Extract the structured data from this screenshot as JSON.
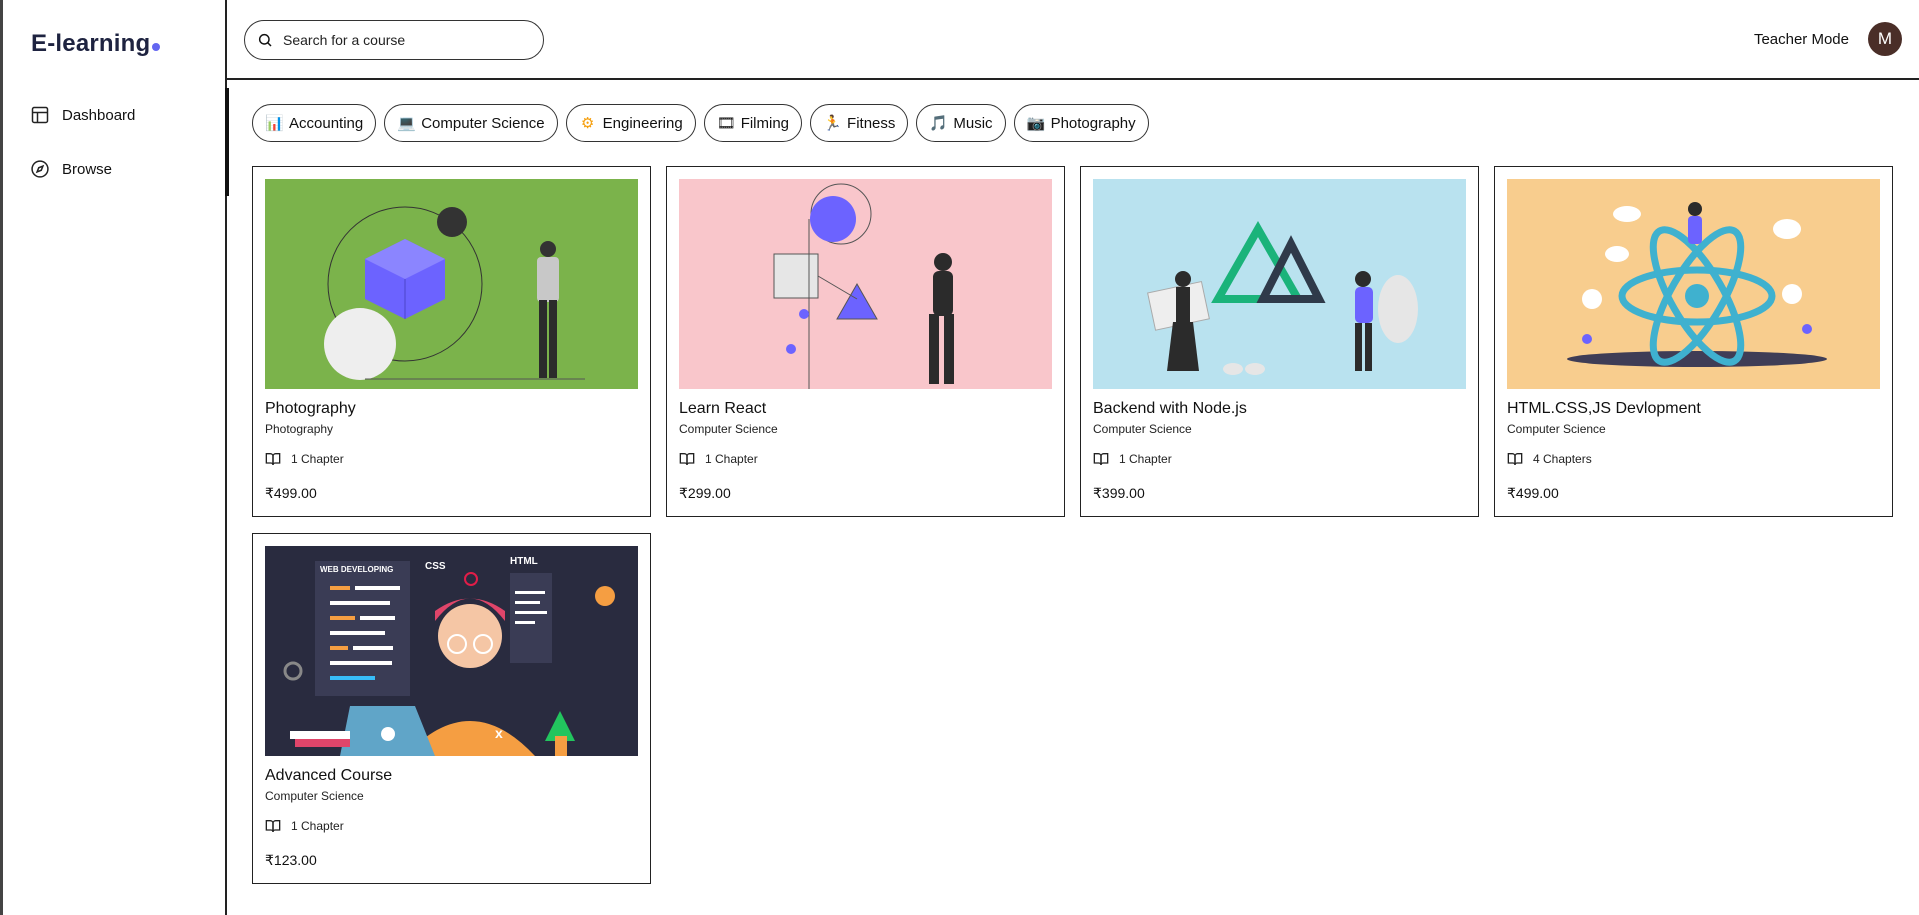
{
  "app": {
    "logo": "E-learning"
  },
  "sidebar": {
    "items": [
      {
        "label": "Dashboard",
        "icon": "layout-icon"
      },
      {
        "label": "Browse",
        "icon": "compass-icon"
      }
    ]
  },
  "header": {
    "search_placeholder": "Search for a course",
    "teacher_mode": "Teacher Mode",
    "avatar_initial": "M"
  },
  "categories": [
    {
      "label": "Accounting",
      "emoji": "📊"
    },
    {
      "label": "Computer Science",
      "emoji": "💻"
    },
    {
      "label": "Engineering",
      "emoji": "⚙"
    },
    {
      "label": "Filming",
      "emoji": "🎞"
    },
    {
      "label": "Fitness",
      "emoji": "🏃"
    },
    {
      "label": "Music",
      "emoji": "🎵"
    },
    {
      "label": "Photography",
      "emoji": "📷"
    }
  ],
  "courses": [
    {
      "title": "Photography",
      "category": "Photography",
      "chapters": "1 Chapter",
      "price": "₹499.00"
    },
    {
      "title": "Learn React",
      "category": "Computer Science",
      "chapters": "1 Chapter",
      "price": "₹299.00"
    },
    {
      "title": "Backend with Node.js",
      "category": "Computer Science",
      "chapters": "1 Chapter",
      "price": "₹399.00"
    },
    {
      "title": "HTML.CSS,JS Devlopment",
      "category": "Computer Science",
      "chapters": "4 Chapters",
      "price": "₹499.00"
    },
    {
      "title": "Advanced Course",
      "category": "Computer Science",
      "chapters": "1 Chapter",
      "price": "₹123.00"
    }
  ],
  "thumbnail_text": {
    "web_developing": "WEB DEVELOPING",
    "css": "CSS",
    "html": "HTML"
  },
  "colors": {
    "accent": "#6366f1",
    "thumb_green": "#7bb34b",
    "thumb_pink": "#f9c6cb",
    "thumb_blue": "#b9e2ef",
    "thumb_orange": "#f8cd8e",
    "thumb_dark": "#292b3f"
  }
}
